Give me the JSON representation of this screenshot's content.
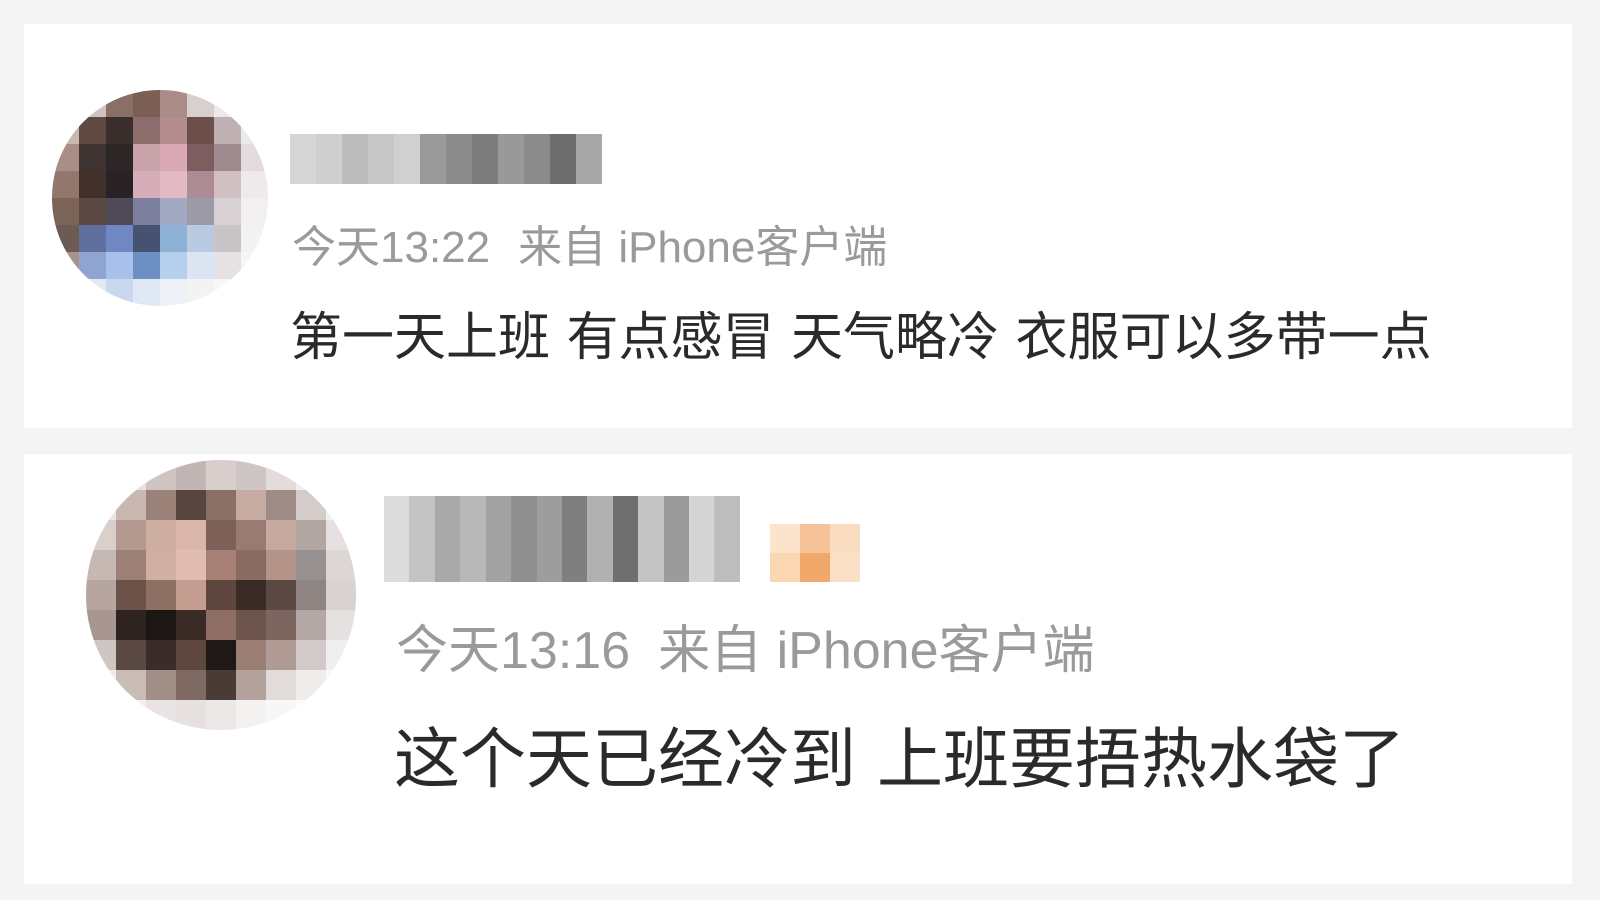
{
  "comments": [
    {
      "time": "今天13:22",
      "source": "来自 iPhone客户端",
      "text": "第一天上班 有点感冒 天气略冷 衣服可以多带一点"
    },
    {
      "time": "今天13:16",
      "source": "来自 iPhone客户端",
      "text": "这个天已经冷到 上班要捂热水袋了"
    }
  ],
  "colors": {
    "page_background": "#f4f4f4",
    "card_background": "#ffffff",
    "meta_text": "#9a9a9a",
    "body_text": "#2a2a2a",
    "badge_accent": "#f2a86a"
  }
}
